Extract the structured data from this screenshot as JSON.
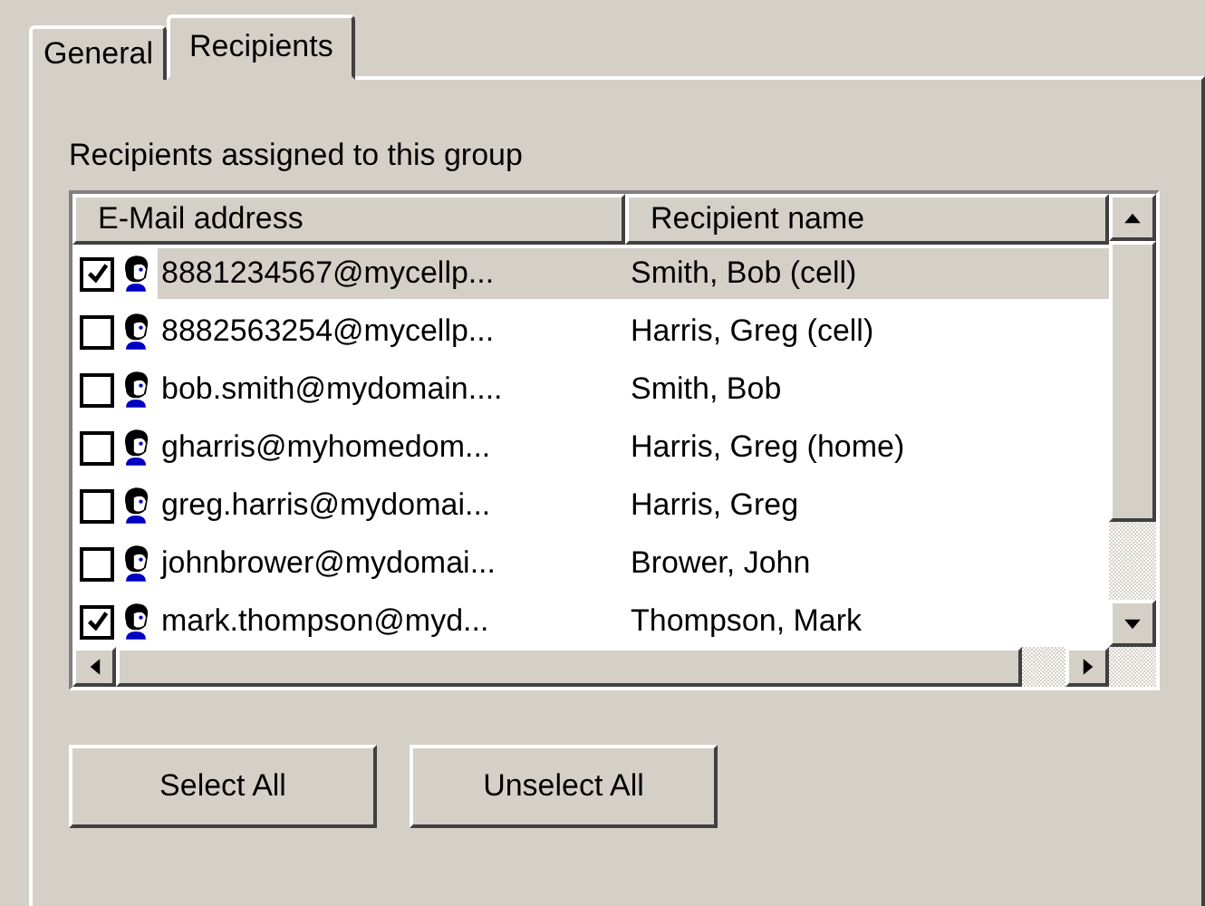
{
  "tabs": [
    {
      "label": "General",
      "selected": false
    },
    {
      "label": "Recipients",
      "selected": true
    }
  ],
  "group_label": "Recipients assigned to this group",
  "table": {
    "columns": [
      "E-Mail address",
      "Recipient name"
    ],
    "rows": [
      {
        "email": "8881234567@mycellp...",
        "name": "Smith, Bob (cell)",
        "checked": true,
        "selected": true
      },
      {
        "email": "8882563254@mycellp...",
        "name": "Harris, Greg (cell)",
        "checked": false,
        "selected": false
      },
      {
        "email": "bob.smith@mydomain....",
        "name": "Smith, Bob",
        "checked": false,
        "selected": false
      },
      {
        "email": "gharris@myhomedom...",
        "name": "Harris, Greg (home)",
        "checked": false,
        "selected": false
      },
      {
        "email": "greg.harris@mydomai...",
        "name": "Harris, Greg",
        "checked": false,
        "selected": false
      },
      {
        "email": "johnbrower@mydomai...",
        "name": "Brower, John",
        "checked": false,
        "selected": false
      },
      {
        "email": "mark.thompson@myd...",
        "name": "Thompson, Mark",
        "checked": true,
        "selected": false
      }
    ]
  },
  "buttons": [
    "Select All",
    "Unselect All"
  ]
}
